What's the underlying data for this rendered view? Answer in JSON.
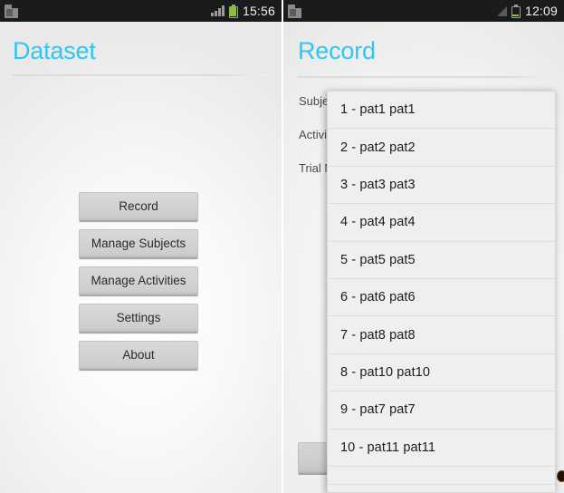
{
  "left_phone": {
    "status_bar": {
      "sd_icon": "sd-card-warning-icon",
      "signal_icon": "signal-bars-icon",
      "battery_icon": "battery-full-icon",
      "time": "15:56"
    },
    "title": "Dataset",
    "buttons": [
      {
        "label": "Record"
      },
      {
        "label": "Manage Subjects"
      },
      {
        "label": "Manage Activities"
      },
      {
        "label": "Settings"
      },
      {
        "label": "About"
      }
    ]
  },
  "right_phone": {
    "status_bar": {
      "sd_icon": "sd-card-warning-icon",
      "signal_icon": "signal-triangle-icon",
      "battery_icon": "battery-low-icon",
      "time": "12:09"
    },
    "title": "Record",
    "form": {
      "rows": [
        {
          "label": "Subject:",
          "value": "1 - pat1 pat1"
        },
        {
          "label": "Activity:",
          "value": ""
        },
        {
          "label": "Trial No:",
          "value": ""
        }
      ]
    },
    "dropdown": {
      "items": [
        {
          "label": "1 - pat1 pat1"
        },
        {
          "label": "2 - pat2 pat2"
        },
        {
          "label": "3 - pat3 pat3"
        },
        {
          "label": "4 - pat4 pat4"
        },
        {
          "label": "5 - pat5 pat5"
        },
        {
          "label": "6 - pat6 pat6"
        },
        {
          "label": "7 - pat8 pat8"
        },
        {
          "label": "8 - pat10 pat10"
        },
        {
          "label": "9 - pat7 pat7"
        },
        {
          "label": "10 - pat11 pat11"
        },
        {
          "label": ""
        }
      ]
    }
  },
  "colors": {
    "accent_title": "#2ec7f2",
    "status_bar_bg": "#1b1b1b",
    "battery_green": "#86c232",
    "dropdown_bg": "#efefef",
    "button_face": "#d2d2d2"
  }
}
